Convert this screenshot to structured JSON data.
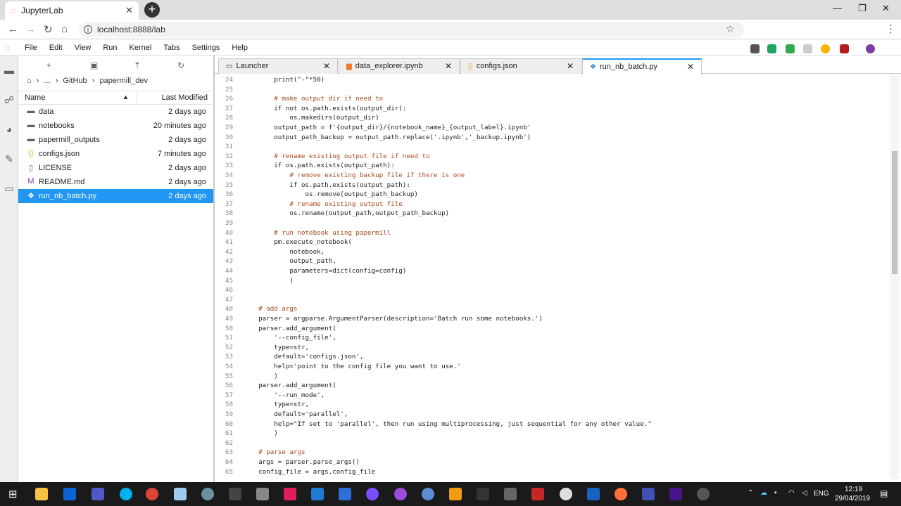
{
  "browser": {
    "tab_title": "JupyterLab",
    "url": "localhost:8888/lab"
  },
  "menu": [
    "File",
    "Edit",
    "View",
    "Run",
    "Kernel",
    "Tabs",
    "Settings",
    "Help"
  ],
  "filebrowser": {
    "breadcrumb": [
      "...",
      "GitHub",
      "papermill_dev"
    ],
    "col_name": "Name",
    "col_modified": "Last Modified",
    "files": [
      {
        "name": "data",
        "date": "2 days ago",
        "icon": "folder-icon"
      },
      {
        "name": "notebooks",
        "date": "20 minutes ago",
        "icon": "folder-icon"
      },
      {
        "name": "papermill_outputs",
        "date": "2 days ago",
        "icon": "folder-icon"
      },
      {
        "name": "configs.json",
        "date": "7 minutes ago",
        "icon": "json-icon"
      },
      {
        "name": "LICENSE",
        "date": "2 days ago",
        "icon": "file-icon"
      },
      {
        "name": "README.md",
        "date": "2 days ago",
        "icon": "markdown-icon"
      },
      {
        "name": "run_nb_batch.py",
        "date": "2 days ago",
        "icon": "python-icon"
      }
    ]
  },
  "doc_tabs": [
    {
      "label": "Launcher",
      "icon": "launcher-icon"
    },
    {
      "label": "data_explorer.ipynb",
      "icon": "notebook-icon"
    },
    {
      "label": "configs.json",
      "icon": "json-icon"
    },
    {
      "label": "run_nb_batch.py",
      "icon": "python-icon"
    }
  ],
  "code": [
    {
      "n": "24",
      "t": "        print(\"-\"*50)"
    },
    {
      "n": "25",
      "t": ""
    },
    {
      "n": "26",
      "t": "        # make output dir if need to"
    },
    {
      "n": "27",
      "t": "        if not os.path.exists(output_dir):"
    },
    {
      "n": "28",
      "t": "            os.makedirs(output_dir)"
    },
    {
      "n": "29",
      "t": "        output_path = f'{output_dir}/{notebook_name}_{output_label}.ipynb'"
    },
    {
      "n": "30",
      "t": "        output_path_backup = output_path.replace('.ipynb','_backup.ipynb')"
    },
    {
      "n": "31",
      "t": ""
    },
    {
      "n": "32",
      "t": "        # rename existing output file if need to"
    },
    {
      "n": "33",
      "t": "        if os.path.exists(output_path):"
    },
    {
      "n": "34",
      "t": "            # remove existing backup file if there is one"
    },
    {
      "n": "35",
      "t": "            if os.path.exists(output_path):"
    },
    {
      "n": "36",
      "t": "                os.remove(output_path_backup)"
    },
    {
      "n": "37",
      "t": "            # rename existing output file"
    },
    {
      "n": "38",
      "t": "            os.rename(output_path,output_path_backup)"
    },
    {
      "n": "39",
      "t": ""
    },
    {
      "n": "40",
      "t": "        # run notebook using papermill"
    },
    {
      "n": "41",
      "t": "        pm.execute_notebook("
    },
    {
      "n": "42",
      "t": "            notebook,"
    },
    {
      "n": "43",
      "t": "            output_path,"
    },
    {
      "n": "44",
      "t": "            parameters=dict(config=config)"
    },
    {
      "n": "45",
      "t": "            )"
    },
    {
      "n": "46",
      "t": ""
    },
    {
      "n": "47",
      "t": ""
    },
    {
      "n": "48",
      "t": "    # add args"
    },
    {
      "n": "49",
      "t": "    parser = argparse.ArgumentParser(description='Batch run some notebooks.')"
    },
    {
      "n": "50",
      "t": "    parser.add_argument("
    },
    {
      "n": "51",
      "t": "        '--config_file',"
    },
    {
      "n": "52",
      "t": "        type=str,"
    },
    {
      "n": "53",
      "t": "        default='configs.json',"
    },
    {
      "n": "54",
      "t": "        help='point to the config file you want to use.'"
    },
    {
      "n": "55",
      "t": "        )"
    },
    {
      "n": "56",
      "t": "    parser.add_argument("
    },
    {
      "n": "57",
      "t": "        '--run_mode',"
    },
    {
      "n": "58",
      "t": "        type=str,"
    },
    {
      "n": "59",
      "t": "        default='parallel',"
    },
    {
      "n": "60",
      "t": "        help=\"If set to 'parallel', then run using multiprocessing, just sequential for any other value.\""
    },
    {
      "n": "61",
      "t": "        )"
    },
    {
      "n": "62",
      "t": ""
    },
    {
      "n": "63",
      "t": "    # parse args"
    },
    {
      "n": "64",
      "t": "    args = parser.parse_args()"
    },
    {
      "n": "65",
      "t": "    config_file = args.config_file"
    }
  ],
  "taskbar": {
    "lang": "ENG",
    "time": "12:19",
    "date": "29/04/2019"
  }
}
